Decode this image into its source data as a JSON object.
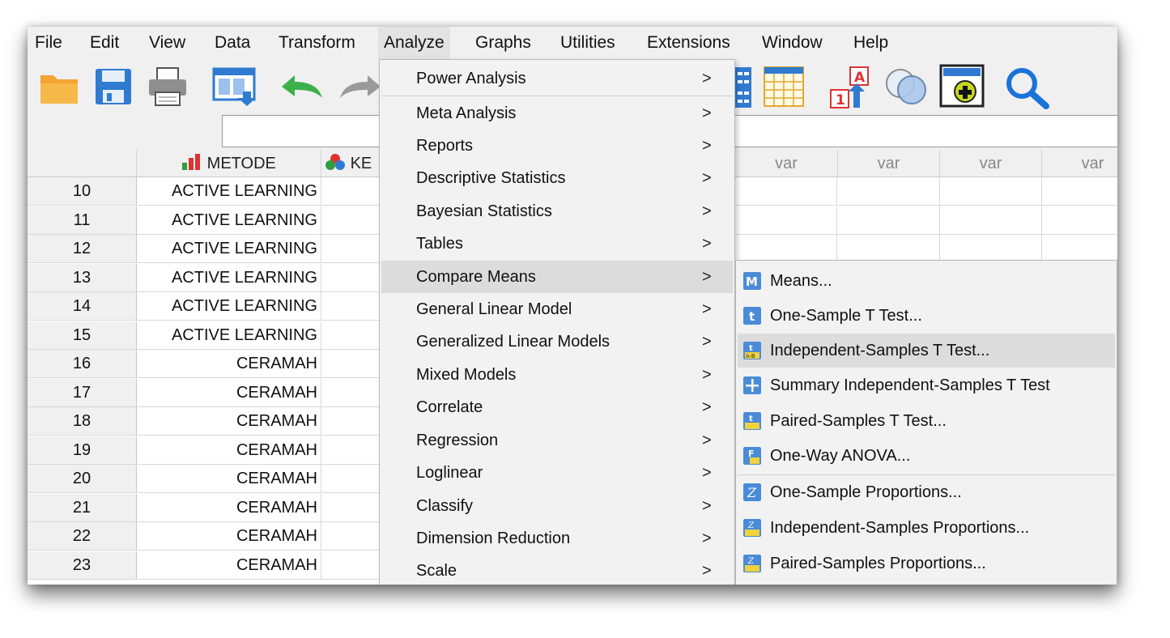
{
  "menubar": [
    {
      "label": "File"
    },
    {
      "label": "Edit"
    },
    {
      "label": "View"
    },
    {
      "label": "Data"
    },
    {
      "label": "Transform"
    },
    {
      "label": "Analyze"
    },
    {
      "label": "Graphs"
    },
    {
      "label": "Utilities"
    },
    {
      "label": "Extensions"
    },
    {
      "label": "Window"
    },
    {
      "label": "Help"
    }
  ],
  "toolbar": [
    {
      "icon": "open-folder-icon"
    },
    {
      "icon": "save-icon"
    },
    {
      "icon": "print-icon"
    },
    {
      "icon": "dialog-recall-icon"
    },
    {
      "icon": "undo-icon"
    },
    {
      "icon": "redo-icon"
    },
    {
      "icon": "split-file-icon"
    },
    {
      "icon": "select-cases-icon"
    },
    {
      "icon": "value-labels-icon"
    },
    {
      "icon": "use-variable-sets-icon"
    },
    {
      "icon": "show-all-variables-icon"
    },
    {
      "icon": "search-icon"
    }
  ],
  "grid": {
    "columns": [
      {
        "name": "METODE",
        "icon": "nominal-bar-icon"
      },
      {
        "name": "KE",
        "icon": "nominal-venn-icon"
      }
    ],
    "var_label": "var",
    "rows": [
      {
        "num": "10",
        "metode": "ACTIVE LEARNING"
      },
      {
        "num": "11",
        "metode": "ACTIVE LEARNING"
      },
      {
        "num": "12",
        "metode": "ACTIVE LEARNING"
      },
      {
        "num": "13",
        "metode": "ACTIVE LEARNING"
      },
      {
        "num": "14",
        "metode": "ACTIVE LEARNING"
      },
      {
        "num": "15",
        "metode": "ACTIVE LEARNING"
      },
      {
        "num": "16",
        "metode": "CERAMAH"
      },
      {
        "num": "17",
        "metode": "CERAMAH"
      },
      {
        "num": "18",
        "metode": "CERAMAH"
      },
      {
        "num": "19",
        "metode": "CERAMAH"
      },
      {
        "num": "20",
        "metode": "CERAMAH"
      },
      {
        "num": "21",
        "metode": "CERAMAH"
      },
      {
        "num": "22",
        "metode": "CERAMAH"
      },
      {
        "num": "23",
        "metode": "CERAMAH"
      }
    ]
  },
  "analyze_menu": {
    "items": [
      {
        "label": "Power Analysis",
        "submenu": true
      },
      {
        "label": "Meta Analysis",
        "submenu": true
      },
      {
        "label": "Reports",
        "submenu": true
      },
      {
        "label": "Descriptive Statistics",
        "submenu": true
      },
      {
        "label": "Bayesian Statistics",
        "submenu": true
      },
      {
        "label": "Tables",
        "submenu": true
      },
      {
        "label": "Compare Means",
        "submenu": true,
        "highlighted": true
      },
      {
        "label": "General Linear Model",
        "submenu": true
      },
      {
        "label": "Generalized Linear Models",
        "submenu": true
      },
      {
        "label": "Mixed Models",
        "submenu": true
      },
      {
        "label": "Correlate",
        "submenu": true
      },
      {
        "label": "Regression",
        "submenu": true
      },
      {
        "label": "Loglinear",
        "submenu": true
      },
      {
        "label": "Classify",
        "submenu": true
      },
      {
        "label": "Dimension Reduction",
        "submenu": true
      },
      {
        "label": "Scale",
        "submenu": true
      }
    ],
    "arrow": ">"
  },
  "compare_means_menu": {
    "items": [
      {
        "label": "Means...",
        "icon": "means-icon"
      },
      {
        "label": "One-Sample T Test...",
        "icon": "one-sample-t-icon"
      },
      {
        "label": "Independent-Samples T Test...",
        "icon": "independent-t-icon",
        "highlighted": true
      },
      {
        "label": "Summary Independent-Samples T Test",
        "icon": "summary-t-icon"
      },
      {
        "label": "Paired-Samples T Test...",
        "icon": "paired-t-icon"
      },
      {
        "label": "One-Way ANOVA...",
        "icon": "anova-icon"
      },
      {
        "label": "One-Sample Proportions...",
        "icon": "one-sample-prop-icon"
      },
      {
        "label": "Independent-Samples Proportions...",
        "icon": "independent-prop-icon"
      },
      {
        "label": "Paired-Samples Proportions...",
        "icon": "paired-prop-icon"
      }
    ]
  },
  "colors": {
    "accent": "#1a73d9",
    "menu_highlight": "#dcdcdc",
    "icon_blue": "#3a7fd5"
  }
}
